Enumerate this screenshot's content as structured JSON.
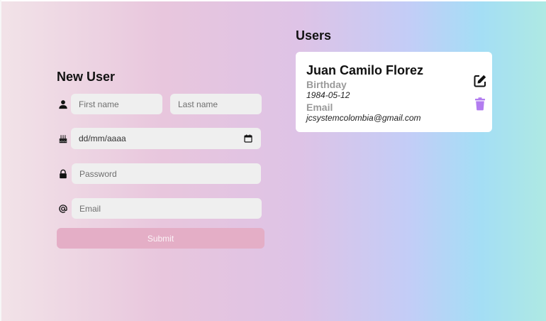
{
  "new_user": {
    "title": "New User",
    "first_name_placeholder": "First name",
    "last_name_placeholder": "Last name",
    "birthday_placeholder": "dd/mm/aaaa",
    "password_placeholder": "Password",
    "email_placeholder": "Email",
    "submit_label": "Submit",
    "icons": {
      "name": "person-icon",
      "birthday": "birthday-cake-icon",
      "password": "lock-icon",
      "email": "at-sign-icon",
      "date": "calendar-icon"
    }
  },
  "users": {
    "title": "Users",
    "list": [
      {
        "name": "Juan Camilo Florez",
        "birthday_label": "Birthday",
        "birthday": "1984-05-12",
        "email_label": "Email",
        "email": "jcsystemcolombia@gmail.com",
        "edit_icon": "edit-icon",
        "delete_icon": "trash-icon"
      }
    ]
  },
  "colors": {
    "submit_bg": "#e4aec6",
    "delete_icon": "#b27cf0",
    "input_bg": "#efefef",
    "card_bg": "#ffffff"
  }
}
